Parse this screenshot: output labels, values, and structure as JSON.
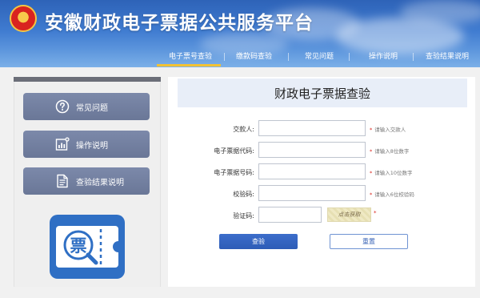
{
  "header": {
    "title": "安徽财政电子票据公共服务平台",
    "emblem_icon": "national-emblem-icon"
  },
  "nav": {
    "items": [
      {
        "label": "电子票号查验",
        "active": true
      },
      {
        "label": "缴款码查验",
        "active": false
      },
      {
        "label": "常见问题",
        "active": false
      },
      {
        "label": "操作说明",
        "active": false
      },
      {
        "label": "查验结果说明",
        "active": false
      }
    ],
    "active_underline_color": "#f3c233"
  },
  "sidebar": {
    "buttons": [
      {
        "label": "常见问题",
        "icon": "question-circle-icon"
      },
      {
        "label": "操作说明",
        "icon": "chart-instructions-icon"
      },
      {
        "label": "查验结果说明",
        "icon": "document-icon"
      }
    ],
    "app_icon": {
      "glyph": "票",
      "icon": "ticket-search-icon"
    }
  },
  "form": {
    "title": "财政电子票据查验",
    "fields": [
      {
        "label": "交款人:",
        "value": "",
        "hint": "请输入交款人"
      },
      {
        "label": "电子票据代码:",
        "value": "",
        "hint": "请输入8位数字"
      },
      {
        "label": "电子票据号码:",
        "value": "",
        "hint": "请输入10位数字"
      },
      {
        "label": "校验码:",
        "value": "",
        "hint": "请输入6位校验码"
      },
      {
        "label": "验证码:",
        "value": ""
      }
    ],
    "required_mark": "*",
    "captcha_text": "点击获取",
    "query_label": "查验",
    "reset_label": "重置"
  },
  "colors": {
    "header_blue": "#3f7bd0",
    "sidebar_button": "#6a7797",
    "primary_button": "#2d5cb6",
    "required_red": "#d9251d"
  }
}
